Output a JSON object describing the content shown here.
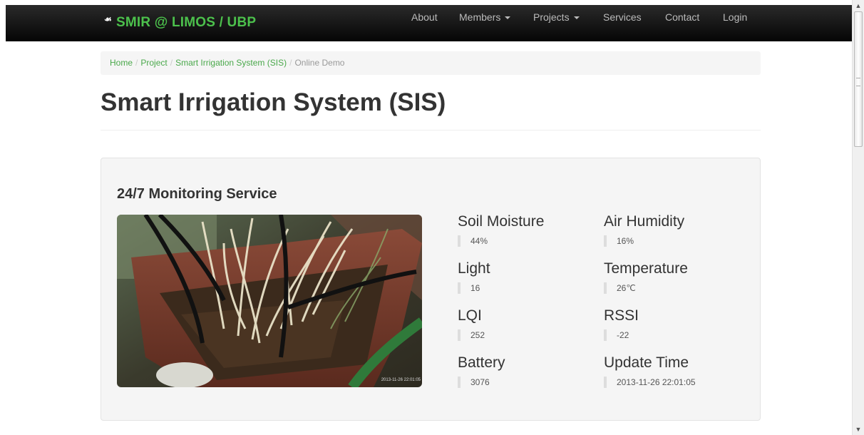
{
  "navbar": {
    "brand": "SMIR @ LIMOS / UBP",
    "items": [
      {
        "label": "About"
      },
      {
        "label": "Members"
      },
      {
        "label": "Projects"
      },
      {
        "label": "Services"
      },
      {
        "label": "Contact"
      },
      {
        "label": "Login"
      }
    ]
  },
  "breadcrumb": {
    "items": [
      "Home",
      "Project",
      "Smart Irrigation System (SIS)"
    ],
    "active": "Online Demo"
  },
  "page": {
    "title": "Smart Irrigation System (SIS)"
  },
  "monitoring": {
    "title": "24/7 Monitoring Service",
    "photo_timestamp": "2013-11-26 22:01:05",
    "metrics": [
      {
        "label": "Soil Moisture",
        "value": "44%"
      },
      {
        "label": "Air Humidity",
        "value": "16%"
      },
      {
        "label": "Light",
        "value": "16"
      },
      {
        "label": "Temperature",
        "value": "26℃"
      },
      {
        "label": "LQI",
        "value": "252"
      },
      {
        "label": "RSSI",
        "value": "-22"
      },
      {
        "label": "Battery",
        "value": "3076"
      },
      {
        "label": "Update Time",
        "value": "2013-11-26 22:01:05"
      }
    ]
  },
  "colors": {
    "brand_green": "#4cc14c",
    "link_green": "#49a84a",
    "navbar_bg": "#111111"
  }
}
